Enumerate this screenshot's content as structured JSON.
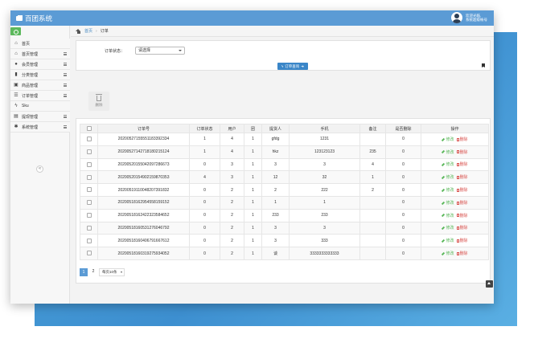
{
  "app": {
    "title": "百团系统"
  },
  "user": {
    "greeting": "欢迎光临,",
    "account": "系统超级帐号"
  },
  "sidebar": {
    "items": [
      {
        "label": "首页",
        "icon": "home-icon",
        "glyph": "⌂",
        "has_handle": false
      },
      {
        "label": "首页管理",
        "icon": "home-icon",
        "glyph": "⌂",
        "has_handle": true
      },
      {
        "label": "会员管理",
        "icon": "user-icon",
        "glyph": "●",
        "has_handle": true
      },
      {
        "label": "分类管理",
        "icon": "bookmark-icon",
        "glyph": "▮",
        "has_handle": true
      },
      {
        "label": "商品管理",
        "icon": "image-icon",
        "glyph": "▣",
        "has_handle": true
      },
      {
        "label": "订单管理",
        "icon": "list-icon",
        "glyph": "☰",
        "has_handle": true
      },
      {
        "label": "Sku",
        "icon": "bolt-icon",
        "glyph": "ϟ",
        "has_handle": false
      },
      {
        "label": "提现管理",
        "icon": "chart-icon",
        "glyph": "▤",
        "has_handle": true
      },
      {
        "label": "系统管理",
        "icon": "cogs-icon",
        "glyph": "✱",
        "has_handle": true
      }
    ],
    "collapse_glyph": "«"
  },
  "breadcrumb": {
    "home": "首页",
    "separator": "›",
    "current": "订单"
  },
  "filter": {
    "label": "订单状态：",
    "select_value": "请选择",
    "search_button": "订单查询"
  },
  "toolbar": {
    "delete_label": "删除"
  },
  "table": {
    "columns": [
      "",
      "订单号",
      "订单状态",
      "用户",
      "团",
      "提货人",
      "手机",
      "备注",
      "是否删除",
      "操作"
    ],
    "rows": [
      [
        "2020052715555118339​2334",
        "1",
        "4",
        "1",
        "gfdg",
        "1231",
        "",
        "0"
      ],
      [
        "20200527142718180215124",
        "1",
        "4",
        "1",
        "hkz",
        "123123123",
        "235",
        "0"
      ],
      [
        "20200520155042097286673",
        "0",
        "3",
        "1",
        "3",
        "3",
        "4",
        "0"
      ],
      [
        "20200520154902159870353",
        "4",
        "3",
        "1",
        "12",
        "32",
        "1",
        "0"
      ],
      [
        "20200519110048207391832",
        "0",
        "2",
        "1",
        "2",
        "222",
        "2",
        "0"
      ],
      [
        "20200518162954558159152",
        "0",
        "2",
        "1",
        "1",
        "1",
        "",
        "0"
      ],
      [
        "20200518162422323584652",
        "0",
        "2",
        "1",
        "233",
        "233",
        "",
        "0"
      ],
      [
        "20200518160531276046792",
        "0",
        "2",
        "1",
        "3",
        "3",
        "",
        "0"
      ],
      [
        "20200518160406791667612",
        "0",
        "2",
        "1",
        "3",
        "333",
        "",
        "0"
      ],
      [
        "20200518160319275934052",
        "0",
        "2",
        "1",
        "谈",
        "3333333333333",
        "",
        "0"
      ]
    ],
    "edit_label": "修改",
    "delete_label": "删除"
  },
  "pagination": {
    "pages": [
      "1",
      "2"
    ],
    "active": "1",
    "page_size": "每页10条"
  },
  "colors": {
    "topbar": "#5b9bd5",
    "accent": "#3a86c8",
    "edit": "#5cb85c",
    "delete": "#d9534f"
  }
}
